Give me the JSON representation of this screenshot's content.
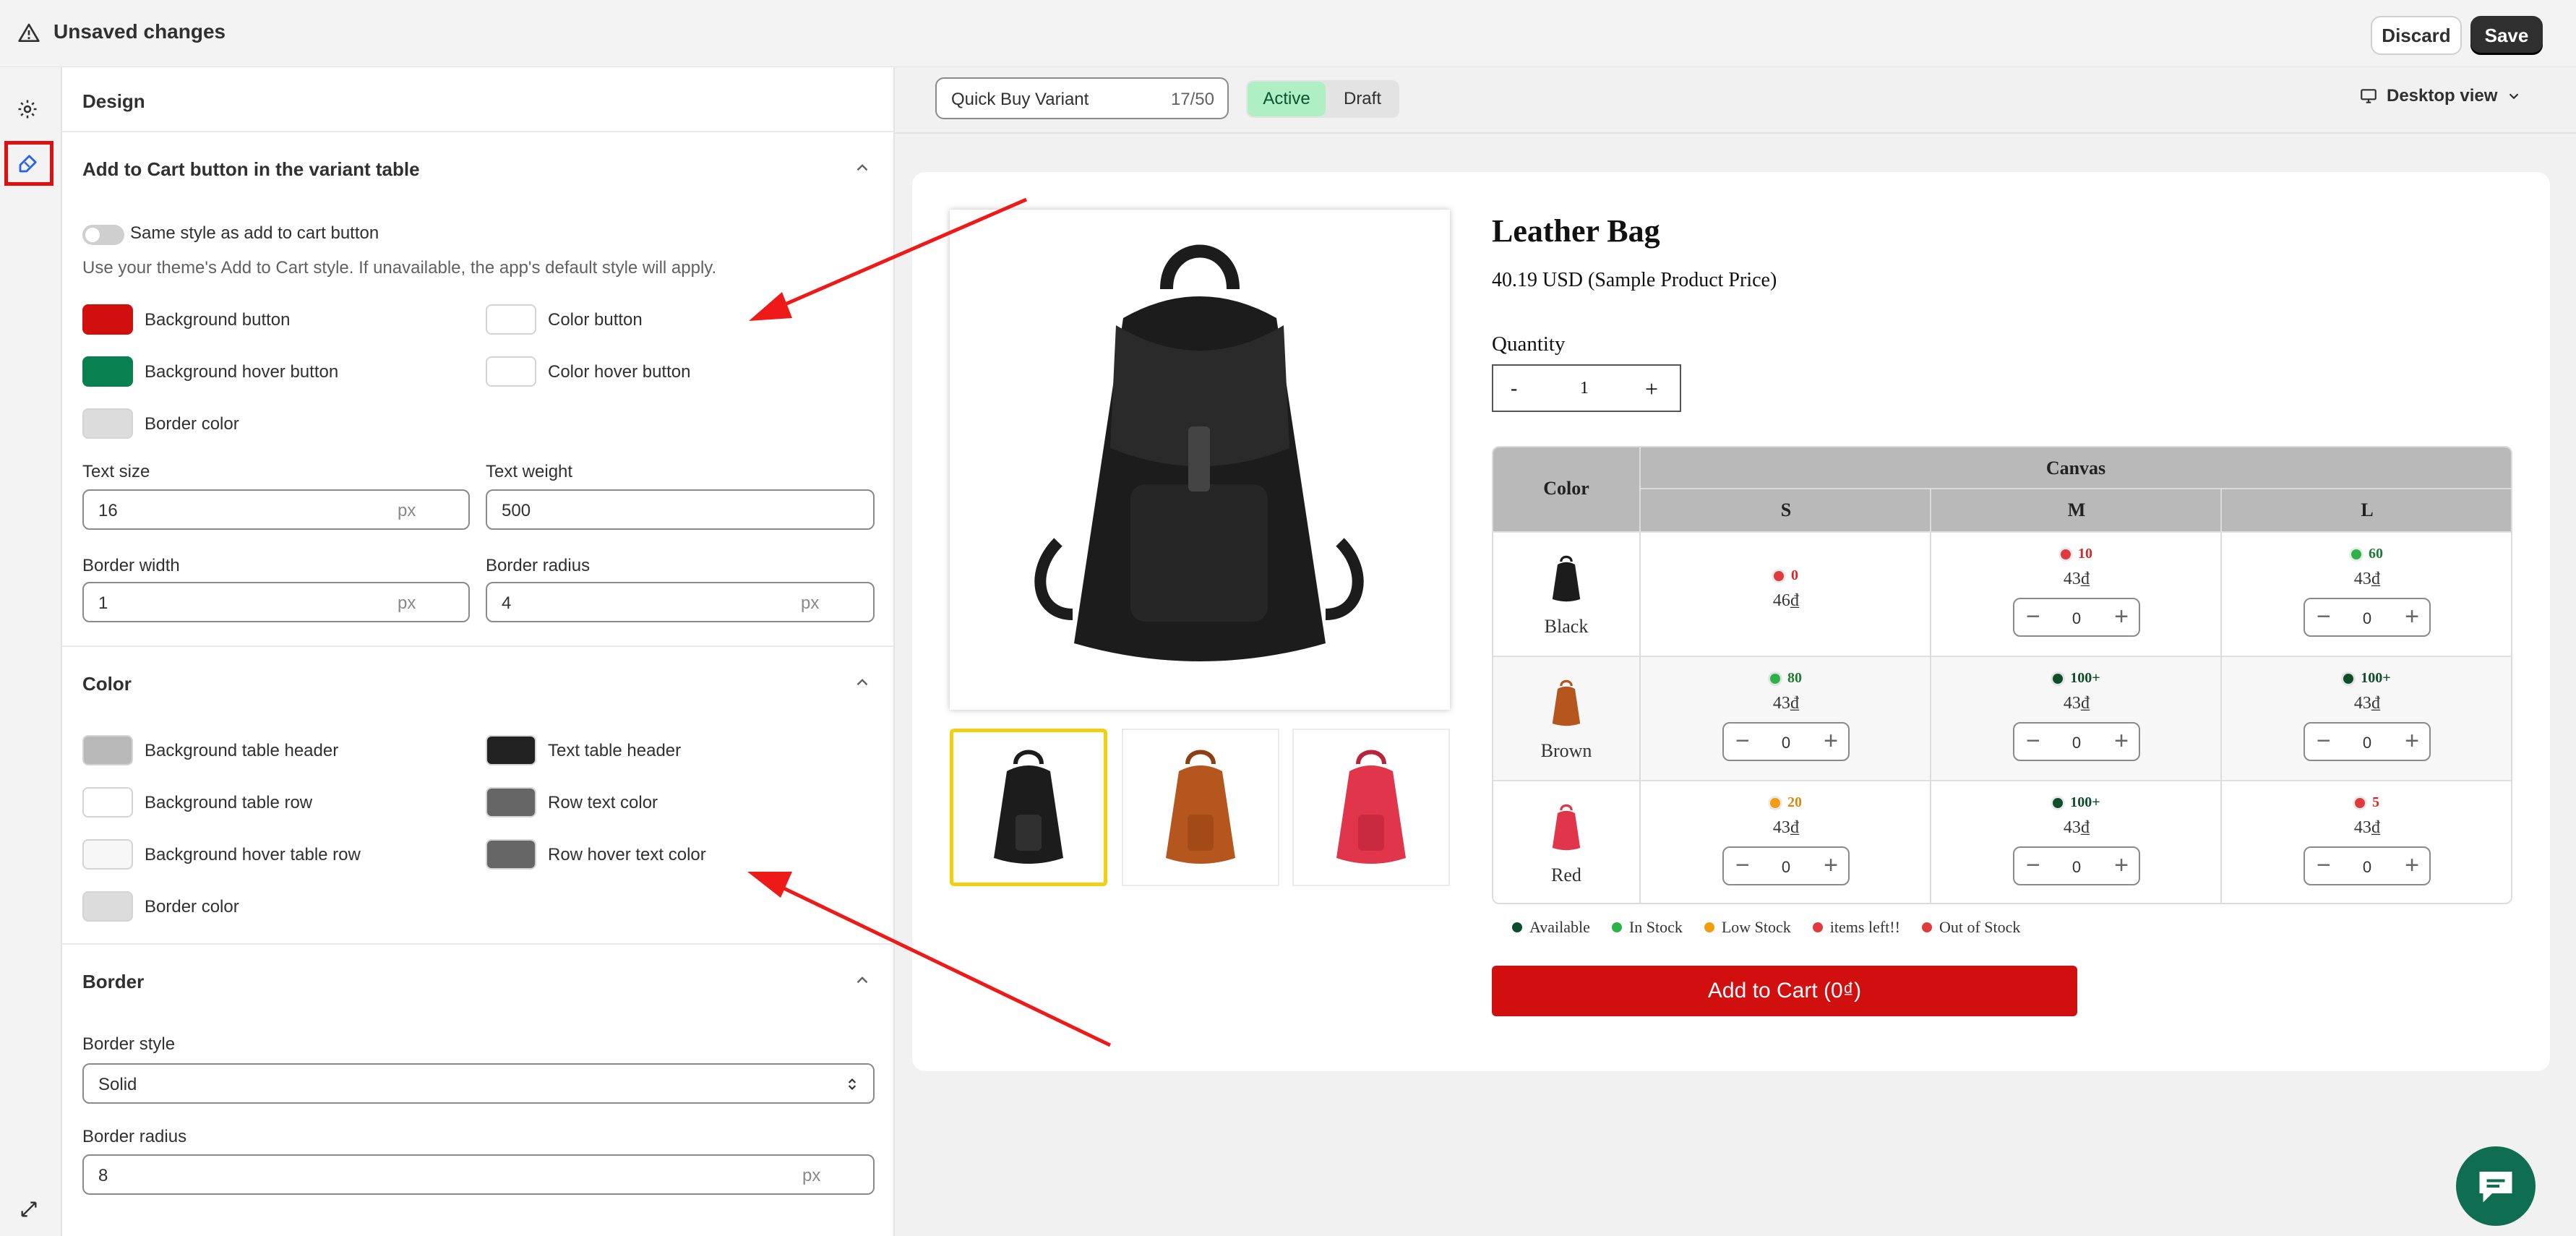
{
  "topbar": {
    "title": "Unsaved changes",
    "discard": "Discard",
    "save": "Save"
  },
  "rail": {
    "icons": [
      "gear-icon",
      "brush-icon",
      "expand-icon"
    ]
  },
  "panel": {
    "design_title": "Design",
    "atc_section": {
      "title": "Add to Cart button in the variant table",
      "same_style_label": "Same style as add to cart button",
      "same_style_on": false,
      "helper": "Use your theme's Add to Cart style. If unavailable, the app's default style will apply.",
      "bg_button": "Background button",
      "bg_button_color": "#d10f0f",
      "color_button": "Color button",
      "color_button_color": "#ffffff",
      "bg_hover_button": "Background hover button",
      "bg_hover_button_color": "#08804f",
      "color_hover_button": "Color hover button",
      "color_hover_button_color": "#ffffff",
      "border_color": "Border color",
      "border_color_value": "#dcdcdc",
      "text_size_label": "Text size",
      "text_size": "16",
      "text_weight_label": "Text weight",
      "text_weight": "500",
      "border_width_label": "Border width",
      "border_width": "1",
      "border_radius_label": "Border radius",
      "border_radius": "4",
      "unit": "px"
    },
    "color_section": {
      "title": "Color",
      "bg_table_header": "Background table header",
      "bg_table_header_color": "#b9b9b9",
      "text_table_header": "Text table header",
      "text_table_header_color": "#222222",
      "bg_table_row": "Background table row",
      "bg_table_row_color": "#ffffff",
      "row_text_color": "Row text color",
      "row_text_color_value": "#666666",
      "bg_hover_table_row": "Background hover table row",
      "bg_hover_table_row_color": "#f7f7f7",
      "row_hover_text_color": "Row hover text color",
      "row_hover_text_color_value": "#666666",
      "border_color": "Border color",
      "border_color_value": "#dcdcdc"
    },
    "border_section": {
      "title": "Border",
      "style_label": "Border style",
      "style_value": "Solid",
      "radius_label": "Border radius",
      "radius_value": "8",
      "unit": "px"
    }
  },
  "preview_bar": {
    "name_value": "Quick Buy Variant",
    "name_count": "17/50",
    "status_active": "Active",
    "status_draft": "Draft",
    "view": "Desktop view"
  },
  "product": {
    "title": "Leather Bag",
    "price": "40.19 USD (Sample Product Price)",
    "quantity_label": "Quantity",
    "quantity_minus": "-",
    "quantity_value": "1",
    "quantity_plus": "+",
    "add_to_cart": "Add to Cart (0₫)"
  },
  "variant_table": {
    "color_header": "Color",
    "group_header": "Canvas",
    "sizes": [
      "S",
      "M",
      "L"
    ],
    "rows": [
      {
        "color": "Black",
        "cells": [
          {
            "stock": "0",
            "status": "out",
            "price": "46₫",
            "stepper": false
          },
          {
            "stock": "10",
            "status": "out",
            "price": "43₫",
            "stepper": true,
            "qty": "0"
          },
          {
            "stock": "60",
            "status": "instock",
            "price": "43₫",
            "stepper": true,
            "qty": "0"
          }
        ]
      },
      {
        "color": "Brown",
        "cells": [
          {
            "stock": "80",
            "status": "instock",
            "price": "43₫",
            "stepper": true,
            "qty": "0"
          },
          {
            "stock": "100+",
            "status": "available",
            "price": "43₫",
            "stepper": true,
            "qty": "0"
          },
          {
            "stock": "100+",
            "status": "available",
            "price": "43₫",
            "stepper": true,
            "qty": "0"
          }
        ]
      },
      {
        "color": "Red",
        "cells": [
          {
            "stock": "20",
            "status": "low",
            "price": "43₫",
            "stepper": true,
            "qty": "0"
          },
          {
            "stock": "100+",
            "status": "available",
            "price": "43₫",
            "stepper": true,
            "qty": "0"
          },
          {
            "stock": "5",
            "status": "out",
            "price": "43₫",
            "stepper": true,
            "qty": "0"
          }
        ]
      }
    ],
    "stepper_minus": "−",
    "stepper_plus": "+",
    "status_colors": {
      "available": "#0d4d2b",
      "instock": "#2fb14a",
      "low": "#f39c12",
      "out": "#e03a3e"
    },
    "status_text_colors": {
      "available": "#0d4d2b",
      "instock": "#1f7a33",
      "low": "#d68910",
      "out": "#d62828"
    }
  },
  "legend": [
    {
      "label": "Available",
      "color": "#0d4d2b"
    },
    {
      "label": "In Stock",
      "color": "#2fb14a"
    },
    {
      "label": "Low Stock",
      "color": "#f39c12"
    },
    {
      "label": "items left!!",
      "color": "#e03a3e"
    },
    {
      "label": "Out of Stock",
      "color": "#e03a3e"
    }
  ],
  "bag_colors": {
    "Black": "#1c1c1c",
    "Brown": "#b5561f",
    "Red": "#e0354a"
  }
}
